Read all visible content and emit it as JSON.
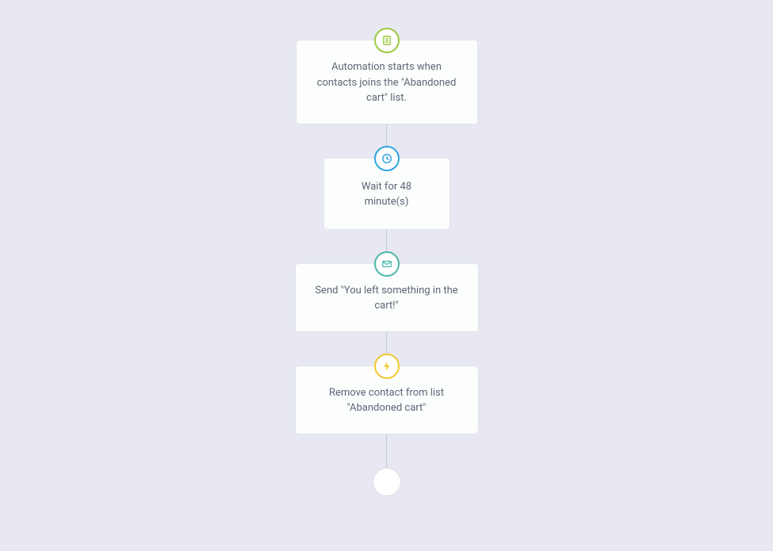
{
  "workflow": {
    "nodes": [
      {
        "type": "trigger",
        "iconColor": "green",
        "iconName": "list-icon",
        "text": "Automation starts when contacts joins the \"Abandoned cart\" list."
      },
      {
        "type": "wait",
        "iconColor": "blue",
        "iconName": "clock-icon",
        "text": "Wait for 48 minute(s)"
      },
      {
        "type": "email",
        "iconColor": "teal",
        "iconName": "envelope-icon",
        "text": "Send \"You left something in the cart!\""
      },
      {
        "type": "action",
        "iconColor": "yellow",
        "iconName": "bolt-icon",
        "text": "Remove contact from list \"Abandoned cart\""
      }
    ]
  }
}
